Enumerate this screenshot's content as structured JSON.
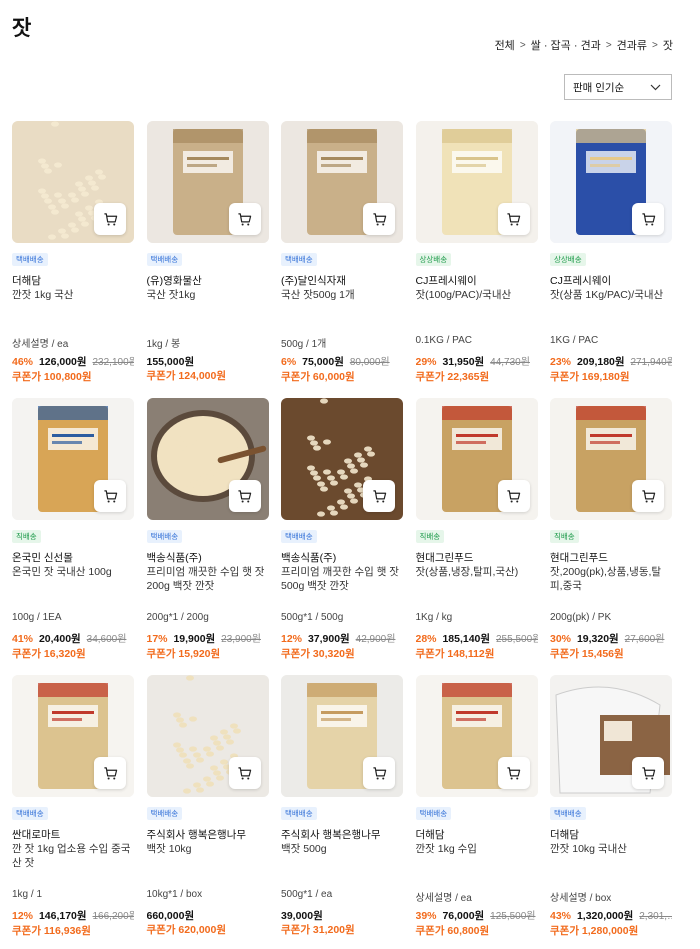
{
  "page": {
    "title": "잣"
  },
  "breadcrumb": [
    "전체",
    "쌀 · 잡곡 · 견과",
    "견과류",
    "잣"
  ],
  "sort": {
    "selected": "판매 인기순"
  },
  "colors": {
    "accent": "#f26b1d",
    "badge_blue": "#3673d8",
    "badge_green": "#1f9b4b"
  },
  "products": [
    {
      "badge": "택배배송",
      "badge_type": "blue",
      "brand": "더해담",
      "name": "깐잣 1kg 국산",
      "unit": "상세설명 / ea",
      "discount": "46%",
      "price": "126,000원",
      "original": "232,100원",
      "coupon": "쿠폰가 100,800원",
      "image_icon": "pine-nut-pile-image"
    },
    {
      "badge": "택배배송",
      "badge_type": "blue",
      "brand": "(유)영화물산",
      "name": "국산 잣1kg",
      "unit": "1kg / 봉",
      "discount": "",
      "price": "155,000원",
      "original": "",
      "coupon": "쿠폰가 124,000원",
      "image_icon": "pine-nut-bag-image"
    },
    {
      "badge": "택배배송",
      "badge_type": "blue",
      "brand": "(주)달인식자재",
      "name": "국산 잣500g 1개",
      "unit": "500g / 1개",
      "discount": "6%",
      "price": "75,000원",
      "original": "80,000원",
      "coupon": "쿠폰가 60,000원",
      "image_icon": "pine-nut-bag-image"
    },
    {
      "badge": "상상배송",
      "badge_type": "green",
      "brand": "CJ프레시웨이",
      "name": "잣(100g/PAC)/국내산",
      "unit": "0.1KG / PAC",
      "discount": "29%",
      "price": "31,950원",
      "original": "44,730원",
      "coupon": "쿠폰가 22,365원",
      "image_icon": "pine-nut-clear-bag-image"
    },
    {
      "badge": "상상배송",
      "badge_type": "green",
      "brand": "CJ프레시웨이",
      "name": "잣(상품 1Kg/PAC)/국내산",
      "unit": "1KG / PAC",
      "discount": "23%",
      "price": "209,180원",
      "original": "271,940원",
      "coupon": "쿠폰가 169,180원",
      "image_icon": "pine-nut-blue-bag-image"
    },
    {
      "badge": "직배송",
      "badge_type": "green",
      "brand": "온국민 신선몰",
      "name": "온국민 잣 국내산 100g",
      "unit": "100g / 1EA",
      "discount": "41%",
      "price": "20,400원",
      "original": "34,600원",
      "coupon": "쿠폰가 16,320원",
      "image_icon": "pine-nut-small-pack-image"
    },
    {
      "badge": "택배배송",
      "badge_type": "blue",
      "brand": "백송식품(주)",
      "name": "프리미엄 깨끗한 수입 햇 잣 200g 백잣 깐잣",
      "unit": "200g*1 / 200g",
      "discount": "17%",
      "price": "19,900원",
      "original": "23,900원",
      "coupon": "쿠폰가 15,920원",
      "image_icon": "pine-nut-bowl-image"
    },
    {
      "badge": "택배배송",
      "badge_type": "blue",
      "brand": "백송식품(주)",
      "name": "프리미엄 깨끗한 수입 햇 잣 500g 백잣 깐잣",
      "unit": "500g*1 / 500g",
      "discount": "12%",
      "price": "37,900원",
      "original": "42,900원",
      "coupon": "쿠폰가 30,320원",
      "image_icon": "pine-nut-closeup-image"
    },
    {
      "badge": "직배송",
      "badge_type": "green",
      "brand": "현대그린푸드",
      "name": "잣(상품,냉장,탈피,국산)",
      "unit": "1Kg / kg",
      "discount": "28%",
      "price": "185,140원",
      "original": "255,500원",
      "coupon": "쿠폰가 148,112원",
      "image_icon": "pine-nut-printed-bag-image"
    },
    {
      "badge": "직배송",
      "badge_type": "green",
      "brand": "현대그린푸드",
      "name": "잣,200g(pk),상품,냉동,탈피,중국",
      "unit": "200g(pk) / PK",
      "discount": "30%",
      "price": "19,320원",
      "original": "27,600원",
      "coupon": "쿠폰가 15,456원",
      "image_icon": "pine-nut-printed-bag-image"
    },
    {
      "badge": "택배배송",
      "badge_type": "blue",
      "brand": "싼대로마트",
      "name": "깐 잣 1kg 업소용 수입 중국산 잣",
      "unit": "1kg / 1",
      "discount": "12%",
      "price": "146,170원",
      "original": "166,200원",
      "coupon": "쿠폰가 116,936원",
      "image_icon": "pine-nut-label-bag-image"
    },
    {
      "badge": "택배배송",
      "badge_type": "blue",
      "brand": "주식회사 행복은행나무",
      "name": "백잣 10kg",
      "unit": "10kg*1 / box",
      "discount": "",
      "price": "660,000원",
      "original": "",
      "coupon": "쿠폰가 620,000원",
      "image_icon": "pine-nut-spill-image"
    },
    {
      "badge": "택배배송",
      "badge_type": "blue",
      "brand": "주식회사 행복은행나무",
      "name": "백잣 500g",
      "unit": "500g*1 / ea",
      "discount": "",
      "price": "39,000원",
      "original": "",
      "coupon": "쿠폰가 31,200원",
      "image_icon": "pine-nut-zip-bag-image"
    },
    {
      "badge": "택배배송",
      "badge_type": "blue",
      "brand": "더해담",
      "name": "깐잣 1kg 수입",
      "unit": "상세설명 / ea",
      "discount": "39%",
      "price": "76,000원",
      "original": "125,500원",
      "coupon": "쿠폰가 60,800원",
      "image_icon": "pine-nut-label-bag-image"
    },
    {
      "badge": "택배배송",
      "badge_type": "blue",
      "brand": "더해담",
      "name": "깐잣 10kg 국내산",
      "unit": "상세설명 / box",
      "discount": "43%",
      "price": "1,320,000원",
      "original": "2,301,…",
      "coupon": "쿠폰가 1,280,000원",
      "image_icon": "pine-nut-sack-box-image"
    }
  ]
}
